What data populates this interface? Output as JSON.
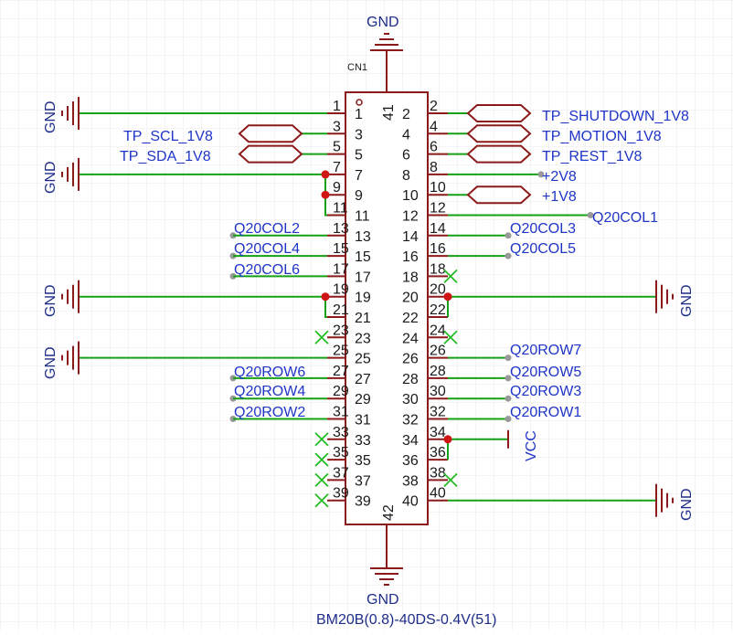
{
  "component": {
    "designator": "CN1",
    "part_number": "BM20B(0.8)-40DS-0.4V(51)",
    "shell_pin_top": "41",
    "shell_pin_bottom": "42"
  },
  "pins_left": [
    "1",
    "3",
    "5",
    "7",
    "9",
    "11",
    "13",
    "15",
    "17",
    "19",
    "21",
    "23",
    "25",
    "27",
    "29",
    "31",
    "33",
    "35",
    "37",
    "39"
  ],
  "pins_right": [
    "2",
    "4",
    "6",
    "8",
    "10",
    "12",
    "14",
    "16",
    "18",
    "20",
    "22",
    "24",
    "26",
    "28",
    "30",
    "32",
    "34",
    "36",
    "38",
    "40"
  ],
  "nets": {
    "gnd": "GND",
    "vcc": "VCC",
    "tp_shutdown": "TP_SHUTDOWN_1V8",
    "tp_motion": "TP_MOTION_1V8",
    "tp_rest": "TP_REST_1V8",
    "tp_scl": "TP_SCL_1V8",
    "tp_sda": "TP_SDA_1V8",
    "p2v8": "+2V8",
    "p1v8": "+1V8",
    "col1": "Q20COL1",
    "col2": "Q20COL2",
    "col3": "Q20COL3",
    "col4": "Q20COL4",
    "col5": "Q20COL5",
    "col6": "Q20COL6",
    "row1": "Q20ROW1",
    "row2": "Q20ROW2",
    "row3": "Q20ROW3",
    "row4": "Q20ROW4",
    "row5": "Q20ROW5",
    "row6": "Q20ROW6",
    "row7": "Q20ROW7"
  },
  "colors": {
    "wire": "#16a016",
    "body": "#8b1a1a",
    "net_label": "#1f35c8",
    "junction": "#d01515",
    "noconnect": "#22bb22",
    "grid": "#e8e8e8"
  }
}
